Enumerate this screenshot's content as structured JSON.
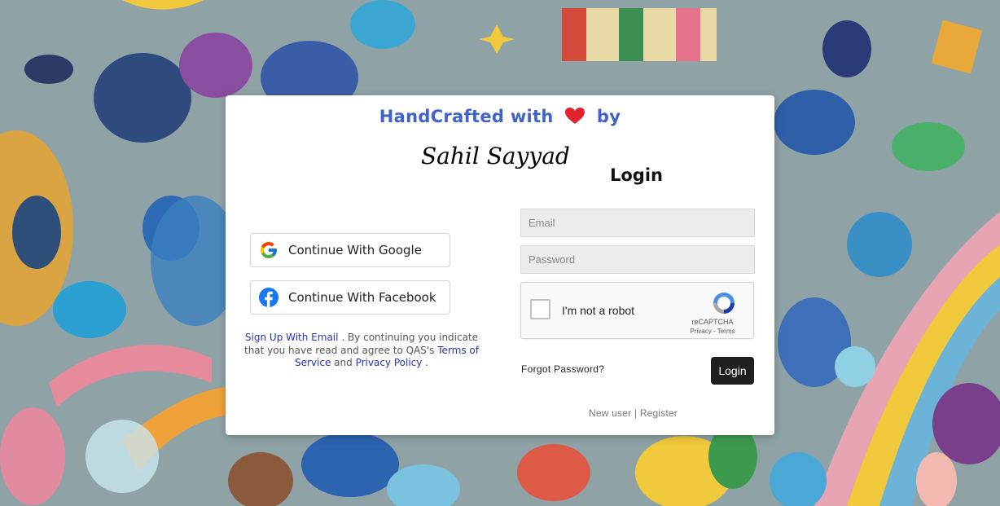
{
  "header": {
    "handcrafted_prefix": "HandCrafted with",
    "handcrafted_suffix": "by",
    "signature": "Sahil Sayyad",
    "login_title": "Login"
  },
  "social": {
    "google_label": "Continue With Google",
    "facebook_label": "Continue With Facebook"
  },
  "terms": {
    "signup_link": "Sign Up With Email",
    "text1": ". By continuing you indicate that you have read and agree to QAS's",
    "terms_link": "Terms of Service",
    "and": "and",
    "privacy_link": "Privacy Policy",
    "end": "."
  },
  "form": {
    "email_placeholder": "Email",
    "password_placeholder": "Password",
    "captcha_label": "I'm not a robot",
    "captcha_brand": "reCAPTCHA",
    "captcha_links": "Privacy - Terms",
    "forgot_password": "Forgot Password?",
    "login_button": "Login",
    "new_user": "New user",
    "separator": "|",
    "register_link": "Register"
  },
  "colors": {
    "headline": "#3f63c9",
    "heart": "#e0232e",
    "link": "#2634b8",
    "login_button_bg": "#1f1f1f"
  },
  "icons": [
    "heart-icon",
    "google-icon",
    "facebook-icon",
    "recaptcha-icon"
  ]
}
